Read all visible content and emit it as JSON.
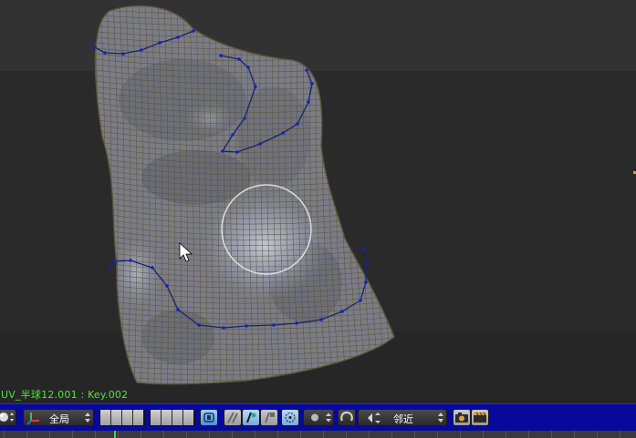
{
  "viewport": {
    "object_label": "UV_半球12.001 : Key.002",
    "colors": {
      "background": "#2a2a2a",
      "upper_band": "#323232",
      "mesh_fill": "#7b7c86",
      "wire": "#5a5436",
      "seam": "#1a2460",
      "vertex": "#1022c8",
      "brush_circle": "#e8e8e8",
      "label": "#54e23a"
    }
  },
  "header": {
    "background": "#07099c",
    "pivot_select": {
      "label": "全局",
      "icon": "axis-gizmo-icon"
    },
    "layer_buttons_a": 4,
    "layer_buttons_b": 4,
    "snap_select": {
      "label": "邻近",
      "icon": "magnet-icon"
    }
  },
  "timeline": {
    "current_frame_marker": "#4fd24f"
  }
}
